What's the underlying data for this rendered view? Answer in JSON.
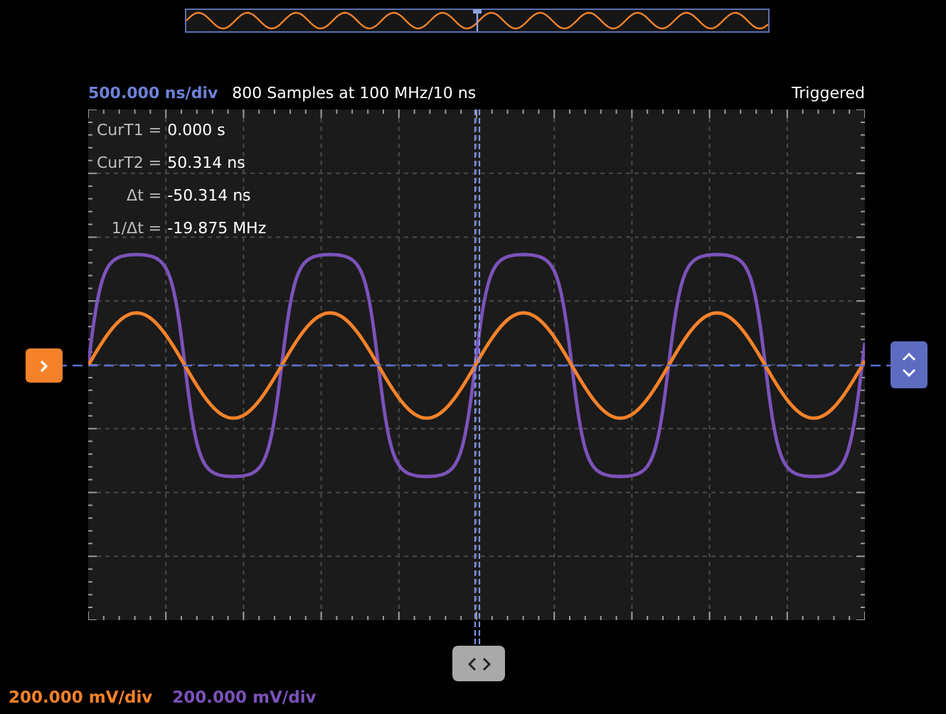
{
  "acquisition": {
    "timebase": "500.000 ns/div",
    "samples": "800 Samples at 100 MHz/10 ns",
    "status": "Triggered"
  },
  "cursors": [
    {
      "label": "CurT1 =",
      "value": "0.000 s"
    },
    {
      "label": "CurT2 =",
      "value": "50.314 ns"
    },
    {
      "label": "Δt =",
      "value": "-50.314 ns"
    },
    {
      "label": "1/Δt =",
      "value": "-19.875 MHz"
    }
  ],
  "channels": [
    {
      "scale": "200.000 mV/div",
      "color": "#f5822a"
    },
    {
      "scale": "200.000 mV/div",
      "color": "#7b52b9"
    }
  ]
}
